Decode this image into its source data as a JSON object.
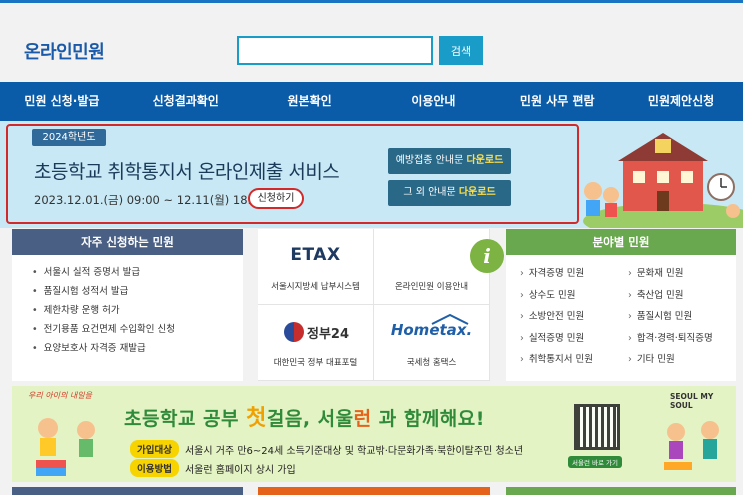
{
  "header": {
    "logo": "온라인민원",
    "search_placeholder": "",
    "search_button": "검색"
  },
  "nav": [
    "민원 신청·발급",
    "신청결과확인",
    "원본확인",
    "이용안내",
    "민원 사무 편람",
    "민원제안신청"
  ],
  "banner": {
    "year": "2024학년도",
    "title": "초등학교 취학통지서 온라인제출 서비스",
    "date": "2023.12.01.(금) 09:00 ~ 12.11(월) 18:00",
    "apply": "신청하기",
    "dl1_text": "예방접종 안내문",
    "dl2_text": "그 외 안내문",
    "dl_label": "다운로드"
  },
  "freq": {
    "title": "자주 신청하는 민원",
    "items": [
      "서울시 실적 증명서 발급",
      "품질시험 성적서 발급",
      "제한차량 운행 허가",
      "전기용품 요건면제 수입확인 신청",
      "요양보호사 자격증 재발급"
    ]
  },
  "services": {
    "etax_logo": "ETAX",
    "etax": "서울시지방세 납부시스템",
    "info_glyph": "i",
    "info": "온라인민원 이용안내",
    "gov24_logo": "정부24",
    "gov24": "대한민국 정부 대표포털",
    "hometax_logo": "Hometax.",
    "hometax": "국세청 홈택스"
  },
  "field": {
    "title": "분야별 민원",
    "items": [
      "자격증명 민원",
      "문화재 민원",
      "상수도 민원",
      "축산업 민원",
      "소방안전 민원",
      "품질시험 민원",
      "실적증명 민원",
      "합격·경력·퇴직증명",
      "취학통지서 민원",
      "기타 민원"
    ]
  },
  "ad": {
    "corner": "우리 아이의 내일을",
    "title_a": "초등학교 공부 ",
    "title_em": "첫",
    "title_b": "걸음, 서울",
    "title_em2": "런",
    "title_c": " 과 함께해요!",
    "tag1": "가입대상",
    "text1": "서울시 거주 만6~24세 소득기준대상 및 학교밖·다문화가족·북한이탈주민 청소년",
    "tag2": "이용방법",
    "text2": "서울런 홈페이지 상시 가입",
    "qr_caption": "서울런 바로 가기",
    "brand": "SEOUL MY SOUL"
  },
  "colors": {
    "nav": "#0a5ba8",
    "accent": "#1a9cc9",
    "freq_head": "#4a5f84",
    "field_head": "#6aa84f",
    "highlight_box": "#d22a2a"
  }
}
